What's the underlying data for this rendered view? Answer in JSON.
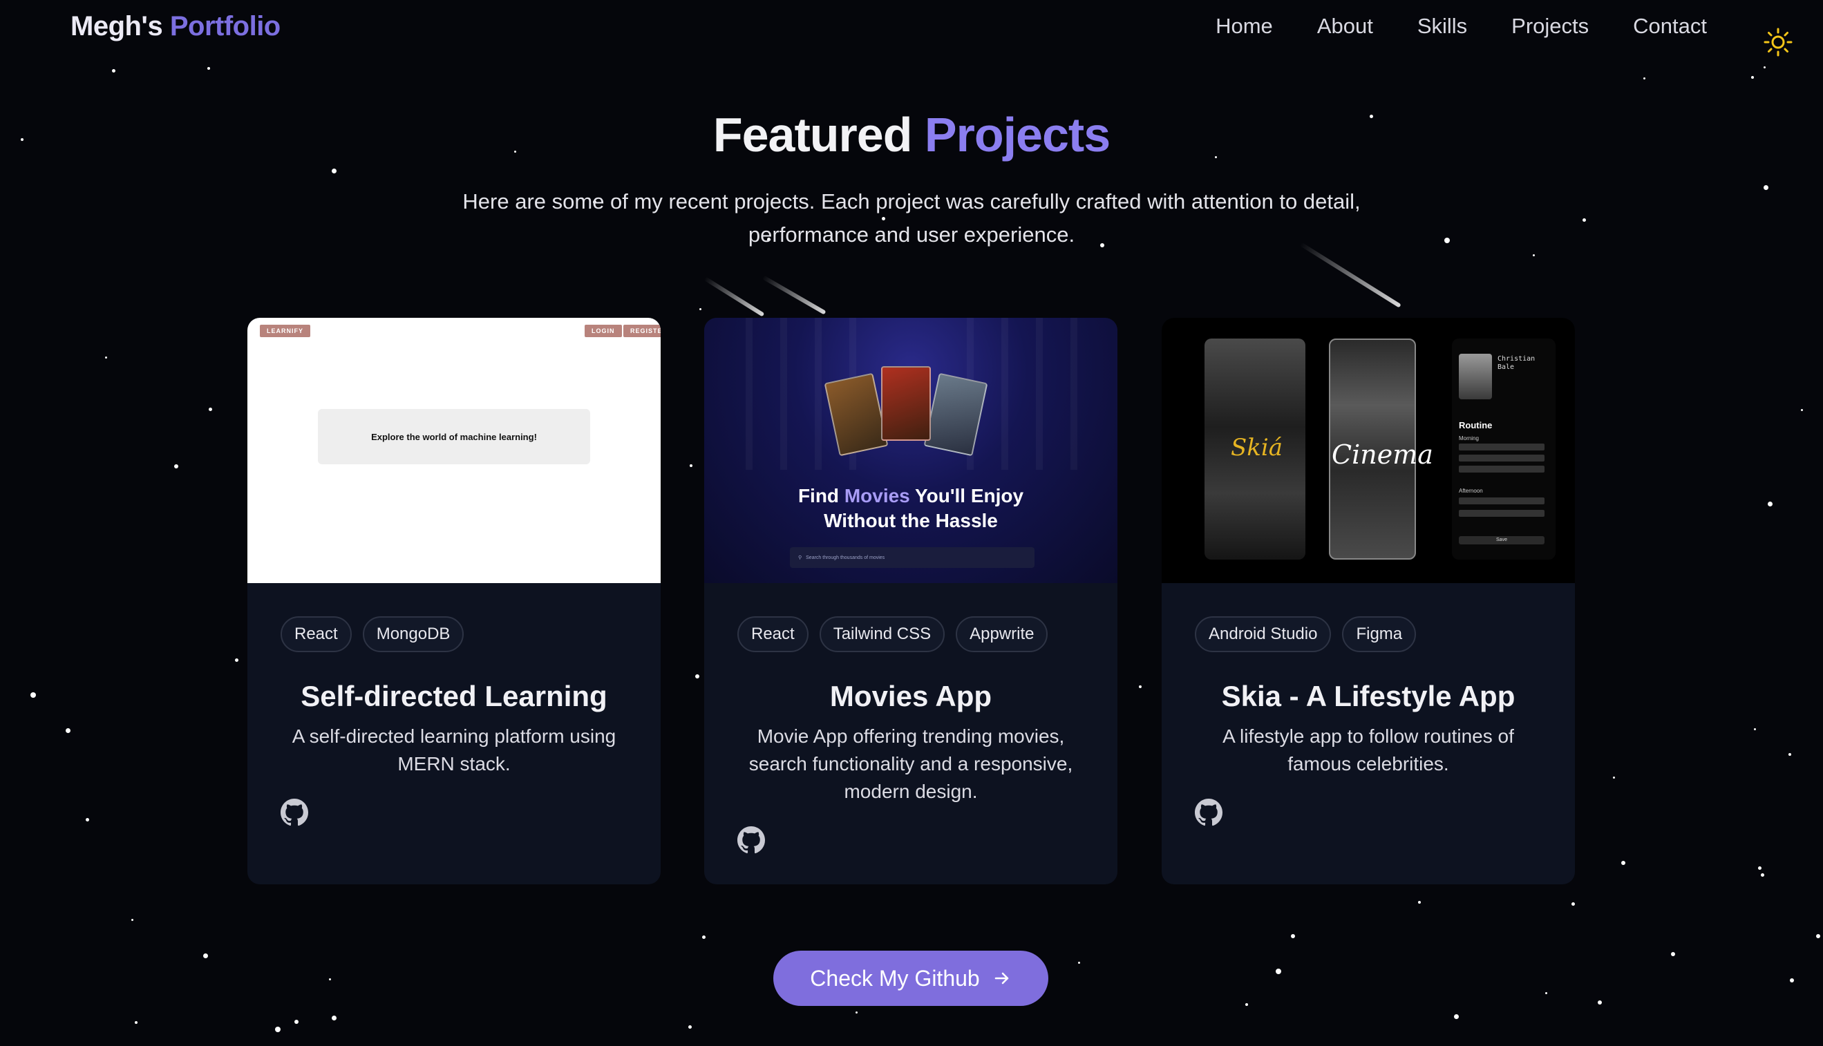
{
  "nav": {
    "logo_name": "Megh's",
    "logo_accent": "Portfolio",
    "links": [
      "Home",
      "About",
      "Skills",
      "Projects",
      "Contact"
    ]
  },
  "section": {
    "title": "Featured",
    "title_accent": "Projects",
    "subtitle": "Here are some of my recent projects. Each project was carefully crafted with attention to detail, performance and user experience."
  },
  "projects": [
    {
      "tags": [
        "React",
        "MongoDB"
      ],
      "title": "Self-directed Learning",
      "description": "A self-directed learning platform using MERN stack.",
      "preview": {
        "logo": "LEARNIFY",
        "login": "LOGIN",
        "register": "REGISTER",
        "hero_text": "Explore the world of machine learning!"
      }
    },
    {
      "tags": [
        "React",
        "Tailwind CSS",
        "Appwrite"
      ],
      "title": "Movies App",
      "description": "Movie App offering trending movies, search functionality and a responsive, modern design.",
      "preview": {
        "heading_pre": "Find ",
        "heading_accent": "Movies",
        "heading_post": " You'll Enjoy",
        "heading_line2": "Without the Hassle",
        "search_placeholder": "Search through thousands of movies"
      }
    },
    {
      "tags": [
        "Android Studio",
        "Figma"
      ],
      "title": "Skia - A Lifestyle App",
      "description": "A lifestyle app to follow routines of famous celebrities.",
      "preview": {
        "brand": "Skiá",
        "cinema": "Cinema",
        "celeb_name": "Christian Bale",
        "routine": "Routine",
        "morning": "Morning",
        "afternoon": "Afternoon",
        "save": "Save"
      }
    }
  ],
  "cta": {
    "label": "Check My Github"
  },
  "colors": {
    "accent": "#7c6fe0",
    "background": "#05060b",
    "card": "#0d1220",
    "sun": "#f5c518"
  },
  "icons": {
    "theme_toggle": "sun-icon",
    "github": "github-icon",
    "cta_arrow": "arrow-right-icon"
  }
}
